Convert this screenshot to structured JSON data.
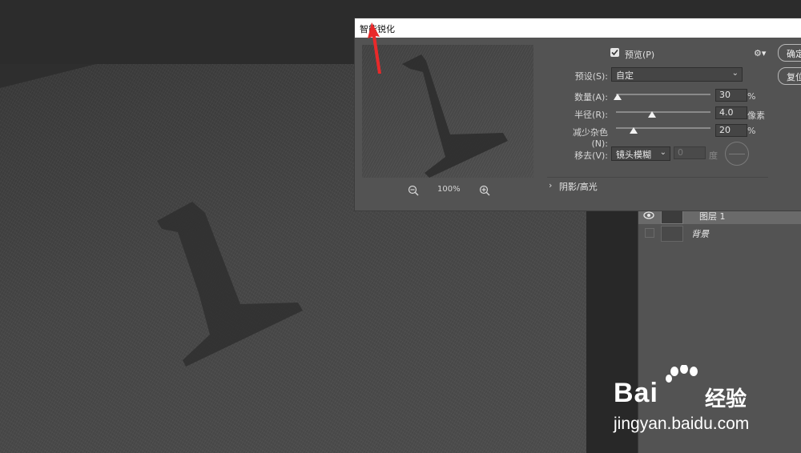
{
  "dialog": {
    "title": "智能锐化",
    "preview_label": "预览(P)",
    "preview_checked": true,
    "zoom_level": "100%",
    "preset": {
      "label": "预设(S):",
      "value": "自定"
    },
    "amount": {
      "label": "数量(A):",
      "value": "30",
      "unit": "%",
      "fraction": 0.02
    },
    "radius": {
      "label": "半径(R):",
      "value": "4.0",
      "unit": "像素",
      "fraction": 0.38
    },
    "noise": {
      "label": "减少杂色(N):",
      "value": "20",
      "unit": "%",
      "fraction": 0.19
    },
    "remove": {
      "label": "移去(V):",
      "value": "镜头模糊",
      "angle_value": "0",
      "angle_unit": "度"
    },
    "shadows_highlights_label": "阴影/高光",
    "buttons": {
      "ok": "确定",
      "reset": "复位"
    }
  },
  "layers": [
    {
      "name": "图层 1",
      "visible": true,
      "selected": true
    },
    {
      "name": "背景",
      "visible": false,
      "selected": false
    }
  ],
  "watermark": {
    "logo_text": "Bai",
    "logo_suffix": "经验",
    "url": "jingyan.baidu.com"
  },
  "colors": {
    "panel": "#535353",
    "canvas_bg": "#2a2a2a",
    "arrow": "#e8292a"
  }
}
